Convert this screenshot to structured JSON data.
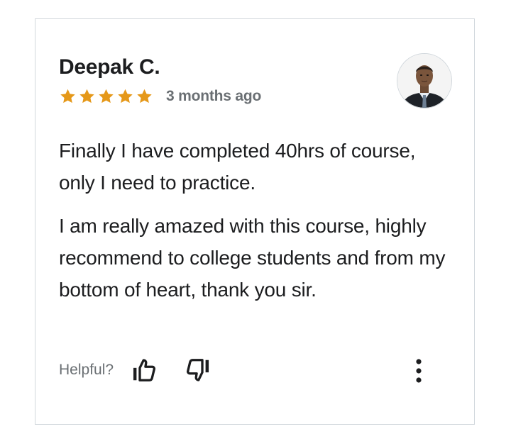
{
  "review": {
    "reviewer_name": "Deepak C.",
    "rating": 5,
    "rating_max": 5,
    "date": "3 months ago",
    "paragraphs": [
      "Finally I have completed 40hrs of course, only I need to practice.",
      "I am really amazed with this course, highly recommend to college students and from my bottom of heart, thank you sir."
    ],
    "avatar_icon": "user-photo"
  },
  "actions": {
    "helpful_label": "Helpful?",
    "thumbs_up_icon": "thumbs-up-icon",
    "thumbs_down_icon": "thumbs-down-icon",
    "more_icon": "more-vertical-icon"
  },
  "colors": {
    "star": "#e59819",
    "text": "#1c1d1f",
    "muted": "#6a6f73",
    "border": "#d1d7dc"
  }
}
